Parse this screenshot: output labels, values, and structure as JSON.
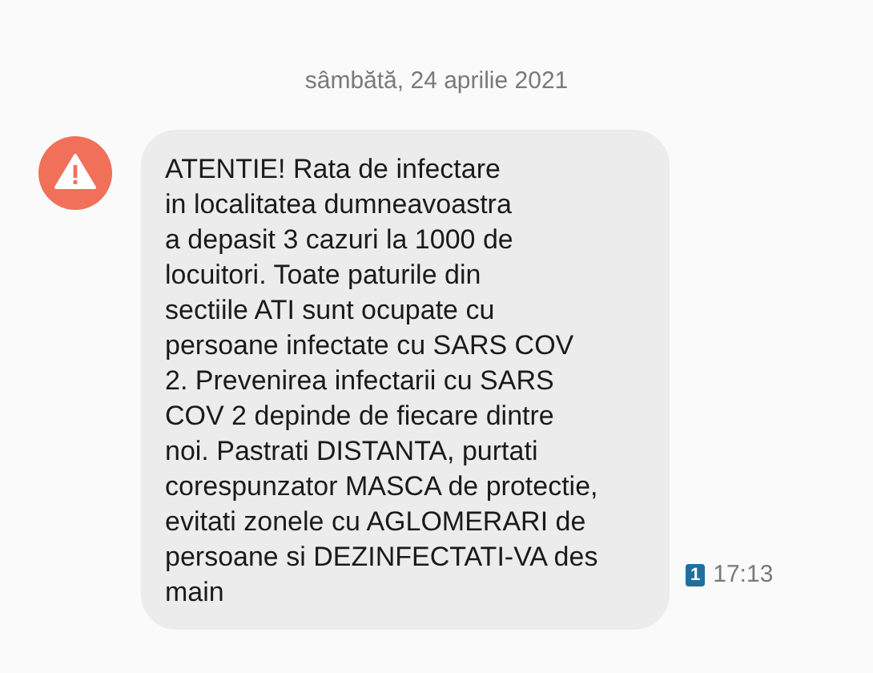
{
  "date_header": "sâmbătă, 24 aprilie 2021",
  "message": {
    "text": "ATENTIE! Rata de infectare\nin localitatea dumneavoastra\na depasit 3 cazuri la 1000 de\nlocuitori. Toate paturile din\nsectiile ATI sunt ocupate cu\npersoane infectate cu SARS COV\n2. Prevenirea infectarii cu SARS\nCOV 2 depinde de fiecare dintre\nnoi. Pastrati DISTANTA, purtati\ncorespunzator MASCA de protectie,\nevitati zonele cu AGLOMERARI de\npersoane si DEZINFECTATI-VA des\nmain",
    "sim": "1",
    "time": "17:13"
  }
}
